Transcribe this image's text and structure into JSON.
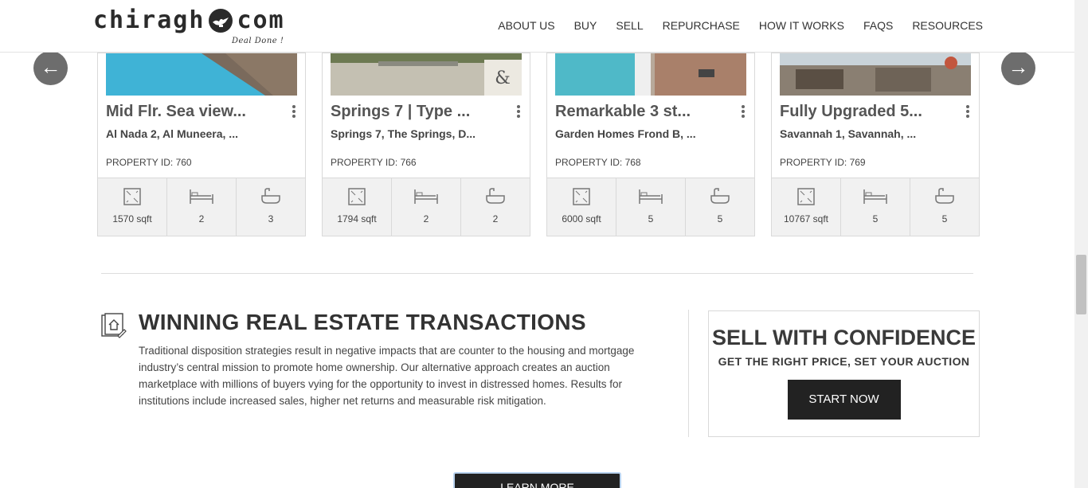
{
  "header": {
    "logo_left": "chiragh",
    "logo_right": "com",
    "tagline": "Deal Done !",
    "nav": [
      "ABOUT US",
      "BUY",
      "SELL",
      "REPURCHASE",
      "HOW IT WORKS",
      "FAQS",
      "RESOURCES"
    ]
  },
  "carousel": {
    "prev": "←",
    "next": "→",
    "cards": [
      {
        "title": "Mid Flr. Sea view...",
        "location": "Al Nada 2, Al Muneera, ...",
        "property_id": "PROPERTY ID: 760",
        "area": "1570 sqft",
        "beds": "2",
        "baths": "3"
      },
      {
        "title": "Springs 7 | Type ...",
        "location": "Springs 7, The Springs, D...",
        "property_id": "PROPERTY ID: 766",
        "area": "1794 sqft",
        "beds": "2",
        "baths": "2"
      },
      {
        "title": "Remarkable 3 st...",
        "location": "Garden Homes Frond B, ...",
        "property_id": "PROPERTY ID: 768",
        "area": "6000 sqft",
        "beds": "5",
        "baths": "5"
      },
      {
        "title": "Fully Upgraded 5...",
        "location": "Savannah 1, Savannah, ...",
        "property_id": "PROPERTY ID: 769",
        "area": "10767 sqft",
        "beds": "5",
        "baths": "5"
      }
    ]
  },
  "winning": {
    "title": "WINNING REAL ESTATE TRANSACTIONS",
    "body": "Traditional disposition strategies result in negative impacts that are counter to the housing and mortgage industry’s central mission to promote home ownership. Our alternative approach creates an auction marketplace with millions of buyers vying for the opportunity to invest in distressed homes. Results for institutions include increased sales, higher net returns and measurable risk mitigation."
  },
  "sell": {
    "title": "SELL WITH CONFIDENCE",
    "subtitle": "GET THE RIGHT PRICE, SET YOUR AUCTION",
    "button": "START NOW"
  },
  "learn_more": "LEARN MORE",
  "colors": {
    "dark_button": "#222222",
    "arrow_bg": "#6d6d6d",
    "stat_bg": "#f1f1f1"
  }
}
